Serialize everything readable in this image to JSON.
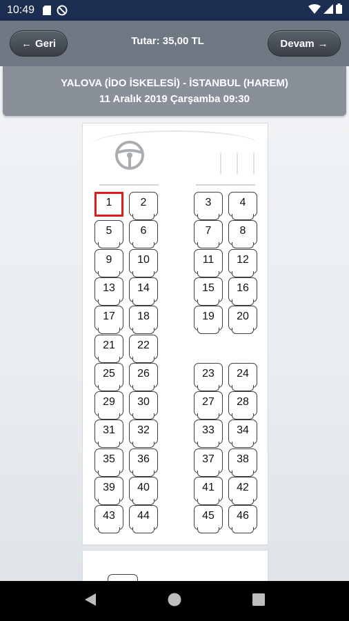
{
  "status_bar": {
    "time": "10:49",
    "icons": [
      "sd-card-icon",
      "no-disturb-icon",
      "wifi-icon",
      "signal-icon",
      "battery-icon"
    ]
  },
  "header": {
    "back_label": "Geri",
    "total_label": "Tutar: 35,00 TL",
    "next_label": "Devam"
  },
  "route": {
    "title": "YALOVA (İDO İSKELESİ) - İSTANBUL (HAREM)",
    "datetime": "11 Aralık 2019 Çarşamba 09:30"
  },
  "seats": {
    "left": [
      [
        "1",
        "2"
      ],
      [
        "5",
        "6"
      ],
      [
        "9",
        "10"
      ],
      [
        "13",
        "14"
      ],
      [
        "17",
        "18"
      ],
      [
        "21",
        "22"
      ],
      [
        "25",
        "26"
      ],
      [
        "29",
        "30"
      ],
      [
        "31",
        "32"
      ],
      [
        "35",
        "36"
      ],
      [
        "39",
        "40"
      ],
      [
        "43",
        "44"
      ]
    ],
    "right": [
      [
        "3",
        "4"
      ],
      [
        "7",
        "8"
      ],
      [
        "11",
        "12"
      ],
      [
        "15",
        "16"
      ],
      [
        "19",
        "20"
      ],
      null,
      [
        "23",
        "24"
      ],
      [
        "27",
        "28"
      ],
      [
        "33",
        "34"
      ],
      [
        "37",
        "38"
      ],
      [
        "41",
        "42"
      ],
      [
        "45",
        "46"
      ]
    ],
    "selected": "1"
  },
  "colors": {
    "status_bar": "#1b2e51",
    "header": "#6f7783",
    "route_card": "#8a9099",
    "selected_seat_border": "#e01919"
  }
}
